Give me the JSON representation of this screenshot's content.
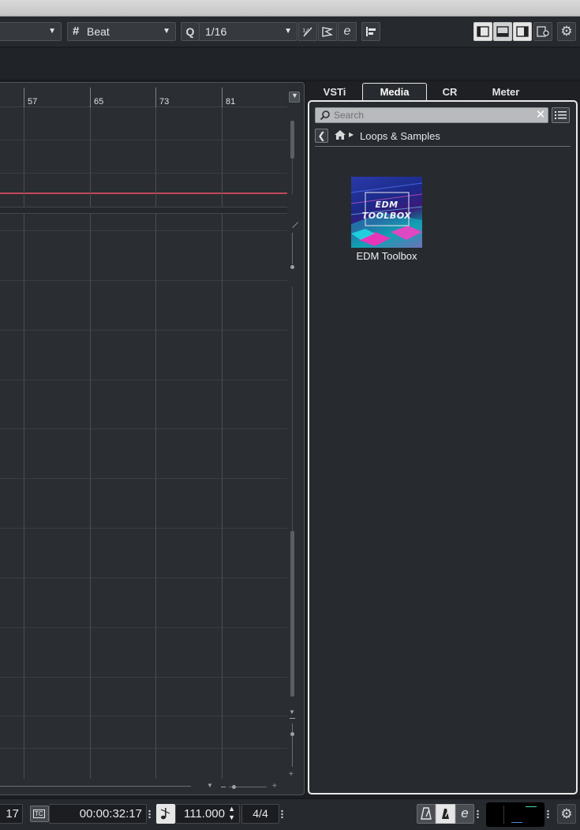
{
  "toolbar": {
    "snap_type": "Beat",
    "quantize_label": "Q",
    "quantize_value": "1/16"
  },
  "ruler": {
    "bars": [
      "57",
      "65",
      "73",
      "81"
    ]
  },
  "right_zone": {
    "tabs": [
      "VSTi",
      "Media",
      "CR",
      "Meter"
    ],
    "active_tab": "Media"
  },
  "media": {
    "search_placeholder": "Search",
    "breadcrumb": "Loops & Samples",
    "items": [
      {
        "title": "EDM Toolbox",
        "cover_text": [
          "EDM",
          "TOOLBOX"
        ]
      }
    ]
  },
  "transport": {
    "bar_value": "17",
    "time_format_badge": "TC",
    "timecode": "00:00:32:17",
    "tempo": "111.000",
    "signature": "4/4"
  },
  "colors": {
    "accent_line": "#c2475d",
    "panel_border": "#e8e8e8",
    "background": "#1b1d20"
  }
}
